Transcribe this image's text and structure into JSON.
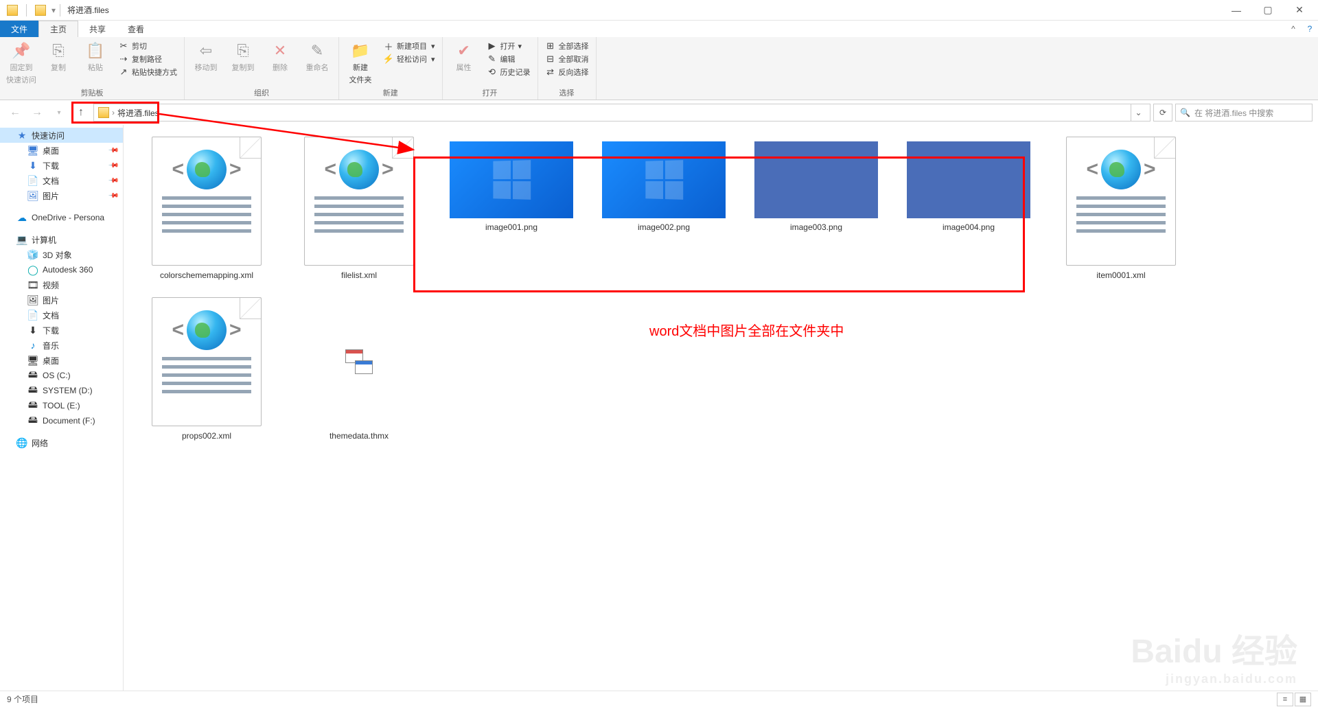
{
  "window": {
    "title": "将进酒.files"
  },
  "tabs": {
    "file": "文件",
    "home": "主页",
    "share": "共享",
    "view": "查看"
  },
  "ribbon": {
    "clipboard": {
      "pin": "固定到",
      "pin2": "快速访问",
      "copy": "复制",
      "paste": "粘贴",
      "cut": "剪切",
      "copypath": "复制路径",
      "shortcut": "粘贴快捷方式",
      "label": "剪贴板"
    },
    "organize": {
      "moveto": "移动到",
      "copyto": "复制到",
      "delete": "删除",
      "rename": "重命名",
      "label": "组织"
    },
    "new": {
      "folder": "新建",
      "folder2": "文件夹",
      "newitem": "新建项目",
      "easy": "轻松访问",
      "label": "新建"
    },
    "open": {
      "props": "属性",
      "open": "打开",
      "edit": "编辑",
      "history": "历史记录",
      "label": "打开"
    },
    "select": {
      "all": "全部选择",
      "none": "全部取消",
      "invert": "反向选择",
      "label": "选择"
    }
  },
  "address": {
    "crumb": "将进酒.files",
    "search_placeholder": "在 将进酒.files 中搜索"
  },
  "sidebar": {
    "quick": "快速访问",
    "desktop": "桌面",
    "downloads": "下载",
    "documents": "文档",
    "pictures": "图片",
    "onedrive": "OneDrive - Persona",
    "computer": "计算机",
    "obj3d": "3D 对象",
    "autodesk": "Autodesk 360",
    "videos": "视频",
    "pictures2": "图片",
    "documents2": "文档",
    "downloads2": "下载",
    "music": "音乐",
    "desktop2": "桌面",
    "osc": "OS (C:)",
    "systemd": "SYSTEM (D:)",
    "toole": "TOOL (E:)",
    "docf": "Document (F:)",
    "network": "网络"
  },
  "files": [
    {
      "name": "colorschememapping.xml",
      "type": "xml"
    },
    {
      "name": "filelist.xml",
      "type": "xml"
    },
    {
      "name": "image001.png",
      "type": "img-win"
    },
    {
      "name": "image002.png",
      "type": "img-win"
    },
    {
      "name": "image003.png",
      "type": "img-plain"
    },
    {
      "name": "image004.png",
      "type": "img-plain"
    },
    {
      "name": "item0001.xml",
      "type": "xml"
    },
    {
      "name": "props002.xml",
      "type": "xml"
    },
    {
      "name": "themedata.thmx",
      "type": "thmx"
    }
  ],
  "status": {
    "count": "9 个项目"
  },
  "annotation": {
    "text": "word文档中图片全部在文件夹中"
  },
  "watermark": {
    "main": "Baidu 经验",
    "sub": "jingyan.baidu.com"
  }
}
